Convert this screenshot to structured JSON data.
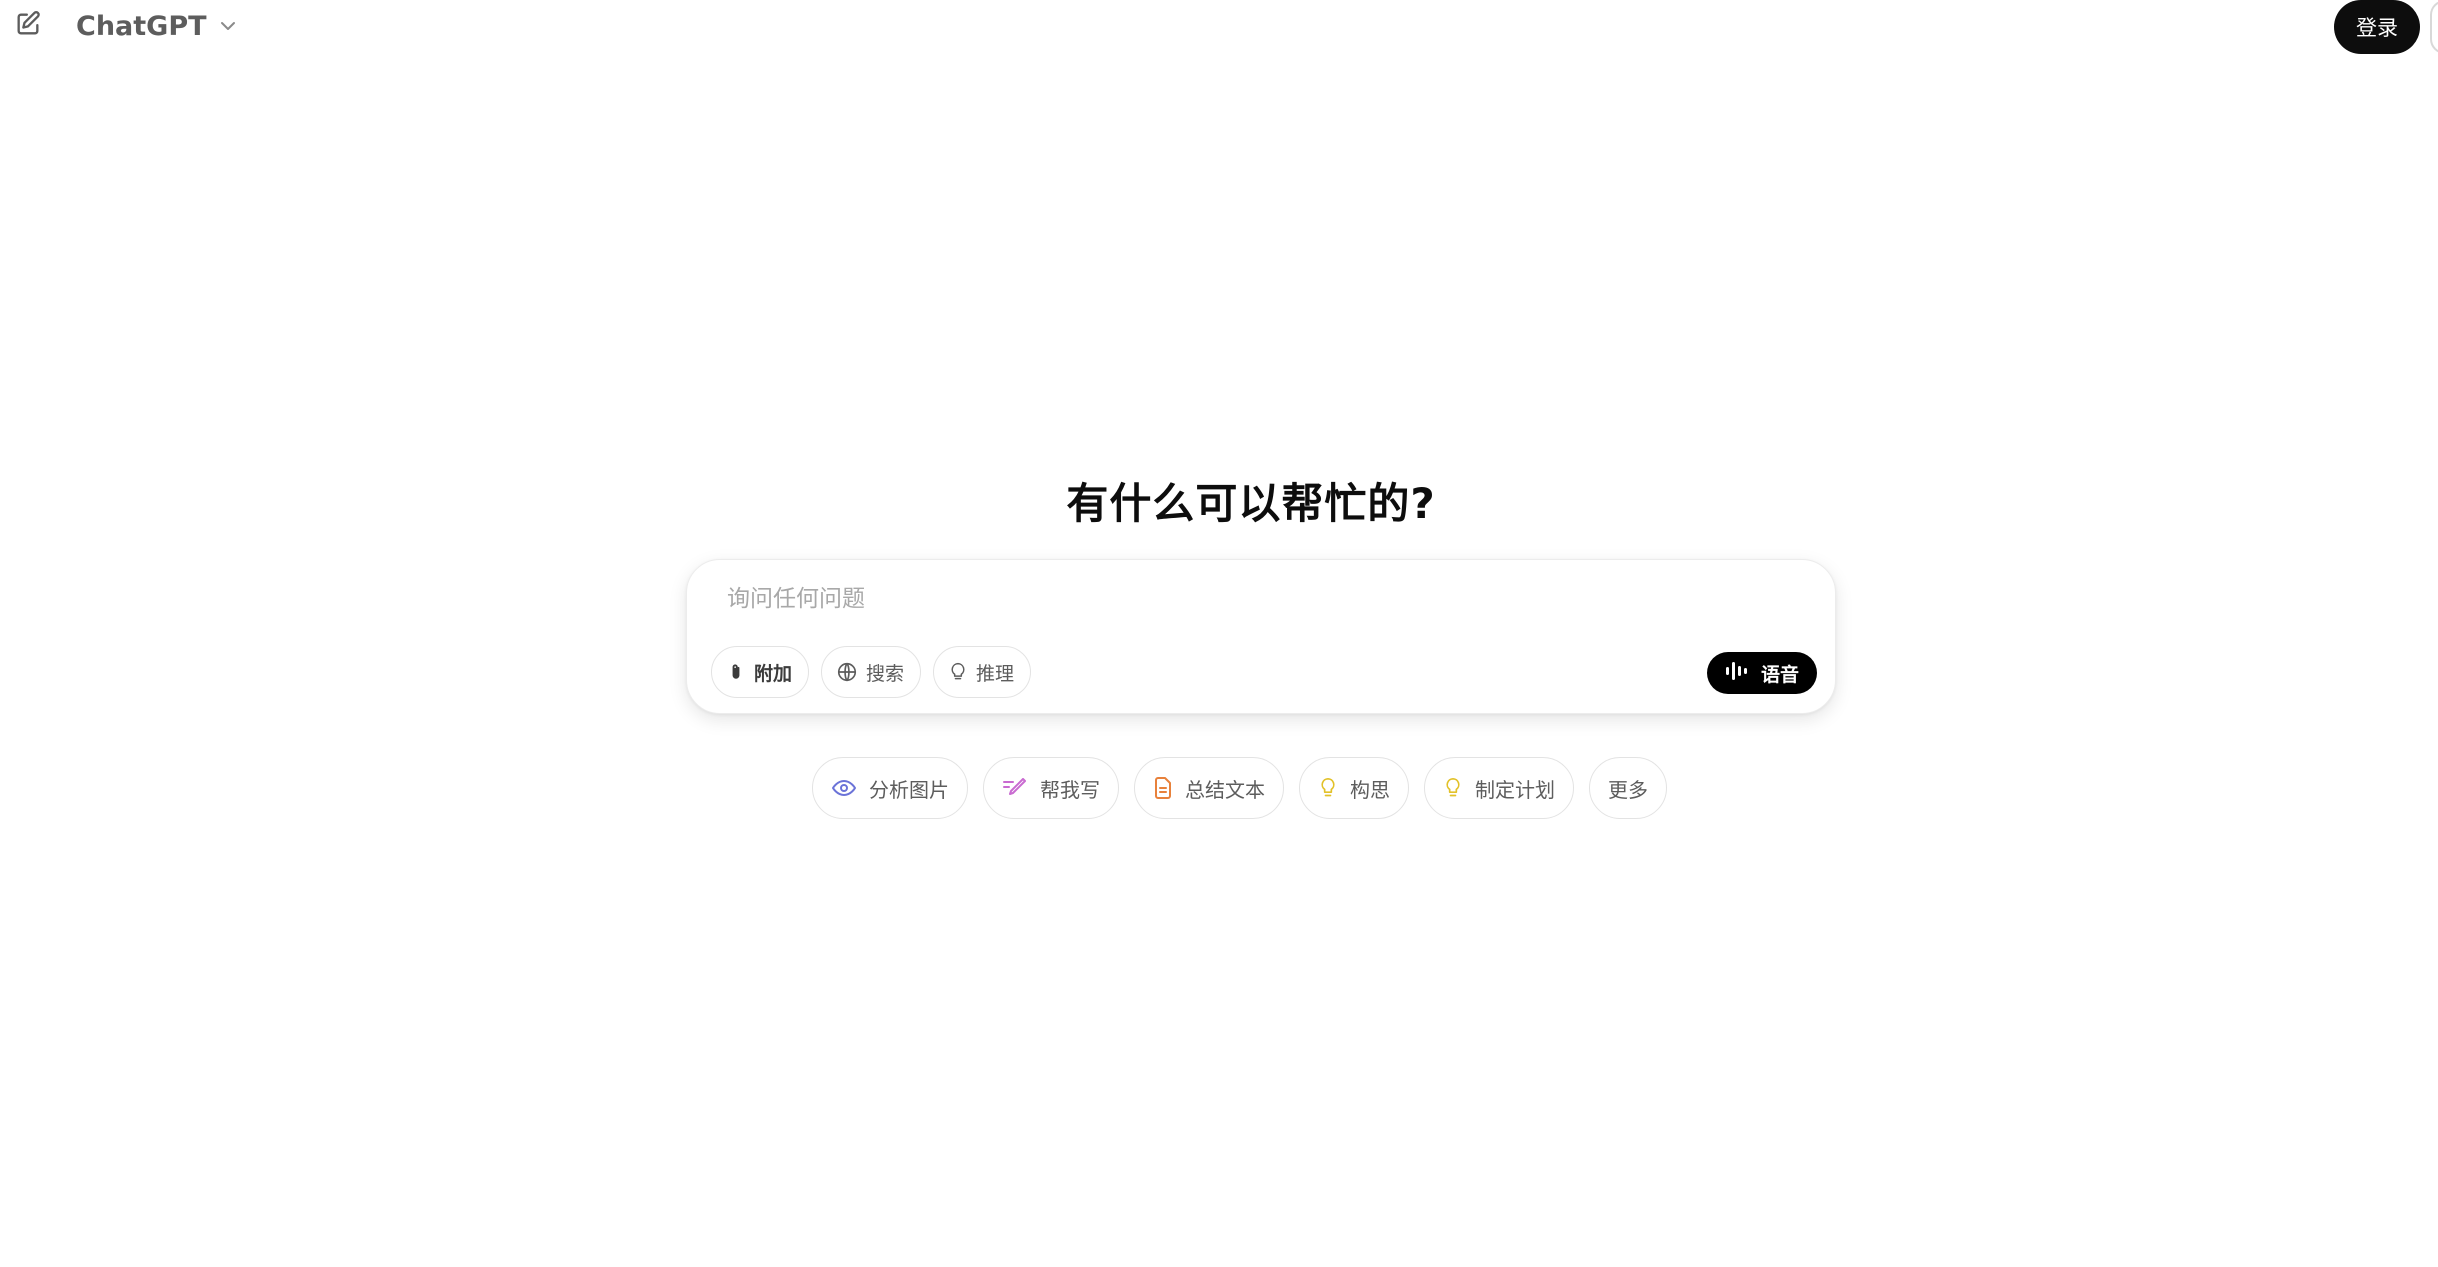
{
  "header": {
    "model_name": "ChatGPT",
    "login_label": "登录"
  },
  "hero": {
    "title": "有什么可以帮忙的?"
  },
  "composer": {
    "placeholder": "询问任何问题",
    "tools": [
      {
        "label": "附加",
        "icon": "paperclip-icon"
      },
      {
        "label": "搜索",
        "icon": "globe-icon"
      },
      {
        "label": "推理",
        "icon": "lightbulb-icon"
      }
    ],
    "voice_label": "语音"
  },
  "suggestions": [
    {
      "label": "分析图片",
      "icon": "eye-icon",
      "color": "#6b73d8"
    },
    {
      "label": "帮我写",
      "icon": "pen-icon",
      "color": "#c96bd1"
    },
    {
      "label": "总结文本",
      "icon": "document-icon",
      "color": "#e8813b"
    },
    {
      "label": "构思",
      "icon": "lightbulb-icon",
      "color": "#e2c128"
    },
    {
      "label": "制定计划",
      "icon": "lightbulb-icon",
      "color": "#e2c128"
    },
    {
      "label": "更多",
      "icon": "",
      "color": ""
    }
  ]
}
